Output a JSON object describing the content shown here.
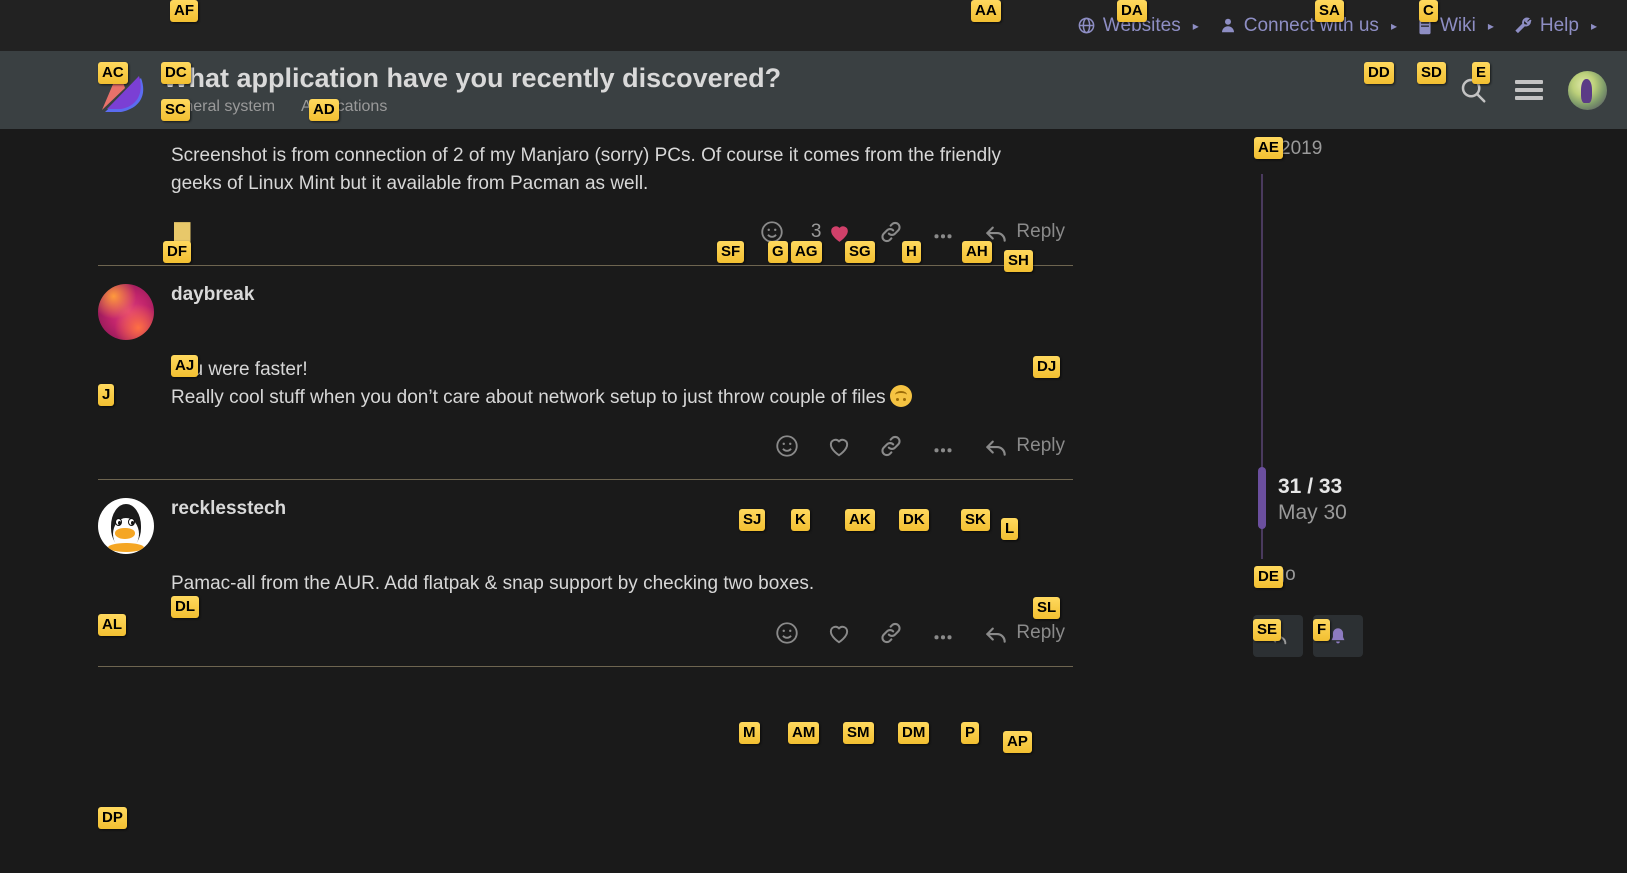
{
  "top_nav": {
    "items": [
      {
        "label": "Websites",
        "icon": "globe-icon",
        "caret": "▸",
        "badge": "AA"
      },
      {
        "label": "Connect with us",
        "icon": "person-icon",
        "caret": "▸",
        "badge": "DA"
      },
      {
        "label": "Wiki",
        "icon": "book-icon",
        "caret": "▸",
        "badge": "SA"
      },
      {
        "label": "Help",
        "icon": "wrench-icon",
        "caret": "▸",
        "badge": "C"
      }
    ],
    "badge_af": "AF"
  },
  "header": {
    "logo_badge": "AC",
    "title": "What application have you recently discovered?",
    "title_badge": "DC",
    "breadcrumbs": [
      {
        "label": "General system",
        "badge": "SC"
      },
      {
        "label": "Applications",
        "badge": "AD"
      }
    ],
    "search_badge": "DD",
    "menu_badge": "SD",
    "avatar_badge": "E"
  },
  "posts": [
    {
      "id": "post-1",
      "body_lines": [
        "Screenshot is from connection of 2 of my Manjaro (sorry) PCs. Of course it comes from the friendly",
        "geeks of Linux Mint but it available from Pacman as well."
      ],
      "bookmark_badge": "DF",
      "actions": {
        "emoji_badge": "SF",
        "like_count": "3",
        "like_count_badge": "G",
        "heart_badge": "AG",
        "heart_filled": true,
        "link_badge": "SG",
        "more_badge": "H",
        "reply_arrow_badge": "AH",
        "reply_label": "Reply",
        "reply_label_badge": "SH"
      }
    },
    {
      "id": "post-2",
      "username": "daybreak",
      "username_badge": "AJ",
      "avatar_badge": "J",
      "avatar_kind": "gradient-pink",
      "time_badge": "DJ",
      "body_lines": [
        "You were faster!",
        "Really cool stuff when you don’t care about network setup to just throw couple of files"
      ],
      "body_emoji": "upside-down-face",
      "actions": {
        "emoji_badge": "SJ",
        "heart_badge": "K",
        "heart_filled": false,
        "link_badge": "AK",
        "more_badge": "DK",
        "reply_arrow_badge": "SK",
        "reply_label": "Reply",
        "reply_label_badge": "L"
      }
    },
    {
      "id": "post-3",
      "username": "recklesstech",
      "username_badge": "DL",
      "avatar_badge": "AL",
      "avatar_kind": "tux",
      "time_badge": "SL",
      "body_lines": [
        "Pamac-all from the AUR. Add flatpak & snap support by checking two boxes."
      ],
      "actions": {
        "emoji_badge": "M",
        "heart_badge": "AM",
        "heart_filled": false,
        "link_badge": "DM",
        "more_badge": "SM",
        "reply_arrow_badge": "P",
        "reply_label": "Reply",
        "reply_label_badge": "AP"
      }
    },
    {
      "id": "post-4",
      "avatar_badge": "DP"
    }
  ],
  "timeline": {
    "top_date": "2019",
    "top_date_badge": "AE",
    "position": "31 / 33",
    "current_date": "May 30",
    "bottom_date": "ago",
    "bottom_date_badge": "DE",
    "reply_button_badge": "SE",
    "notify_button_badge": "F"
  },
  "colors": {
    "page_bg": "#1a1a1a",
    "top_bar_bg": "#222222",
    "header_bg": "#3a4042",
    "nav_link": "#8e8ec4",
    "text_primary": "#d7d7d7",
    "text_muted": "#8a8a8a",
    "divider": "#6e6550",
    "timeline_accent": "#6b4f9e",
    "heart_filled": "#d1406a",
    "badge_bg": "#f2bf31",
    "bookmark": "#e8c86a"
  }
}
